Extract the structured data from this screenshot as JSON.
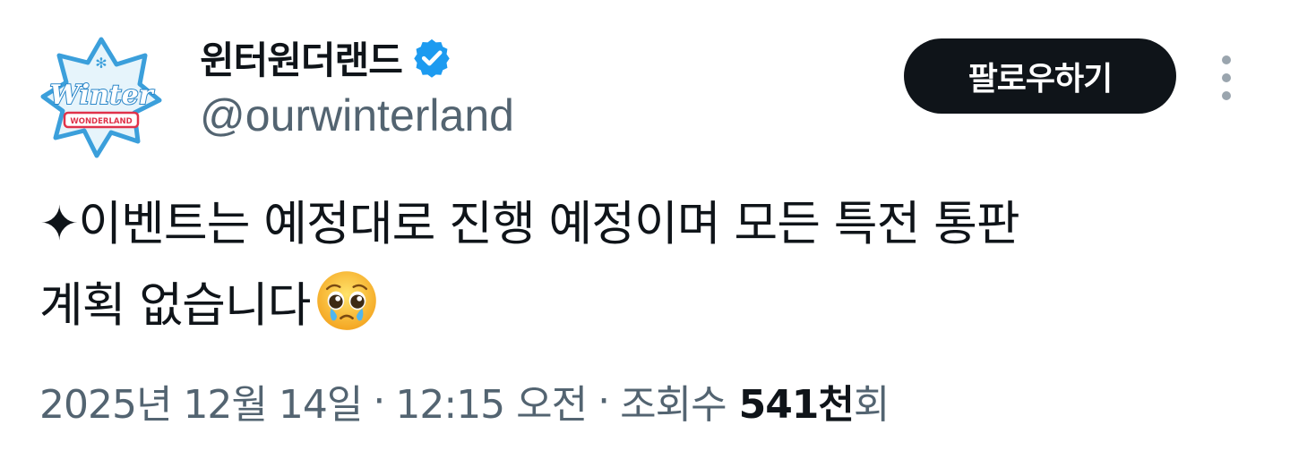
{
  "author": {
    "display_name": "윈터원더랜드",
    "handle": "@ourwinterland",
    "verified": true,
    "verified_color": "#1d9bf0",
    "avatar_logo_title": "Winter",
    "avatar_logo_subtitle": "WONDERLAND"
  },
  "actions": {
    "follow_label": "팔로우하기",
    "more_icon": "more-vertical-icon"
  },
  "tweet": {
    "lines": [
      "✦이벤트는 예정대로 진행 예정이며 모든 특전 통판",
      "계획 없습니다"
    ],
    "emoji": "pleading-face-with-tears-icon"
  },
  "meta": {
    "date": "2025년 12월 14일",
    "separator": "·",
    "time": "12:15 오전",
    "views_label": "조회수",
    "views_count": "541천",
    "views_suffix": "회"
  },
  "colors": {
    "text_primary": "#0f1419",
    "text_secondary": "#536471",
    "button_bg": "#0f1419",
    "button_text": "#ffffff"
  }
}
